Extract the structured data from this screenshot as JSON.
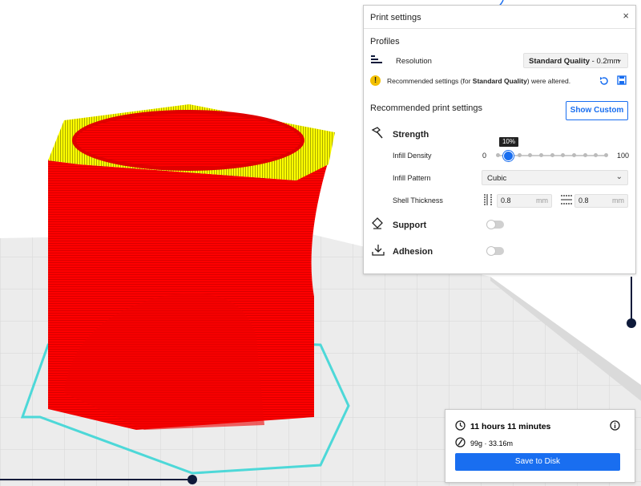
{
  "print_settings": {
    "title": "Print settings",
    "close_label": "×",
    "profiles_label": "Profiles",
    "resolution_label": "Resolution",
    "resolution_value_bold": "Standard Quality",
    "resolution_value_rest": " - 0.2mm",
    "warning": {
      "prefix": "Recommended settings (for ",
      "bold": "Standard Quality",
      "suffix": ") were altered.",
      "icon": "exclamation-icon"
    },
    "recommended_title": "Recommended print settings",
    "show_custom_label": "Show Custom",
    "strength_label": "Strength",
    "infill_density_label": "Infill Density",
    "infill_density_value": "10%",
    "infill_density_fraction": 0.1,
    "slider_min": "0",
    "slider_max": "100",
    "infill_pattern_label": "Infill Pattern",
    "infill_pattern_value": "Cubic",
    "shell_thickness_label": "Shell Thickness",
    "wall_thickness": "0.8",
    "top_bottom_thickness": "0.8",
    "unit": "mm",
    "support_label": "Support",
    "support_enabled": false,
    "adhesion_label": "Adhesion",
    "adhesion_enabled": false
  },
  "job": {
    "time": "11 hours 11 minutes",
    "material": "99g · 33.16m",
    "save_label": "Save to Disk"
  },
  "colors": {
    "accent": "#196ef0",
    "model_body": "#ff0000",
    "model_top": "#ffff00",
    "build_outline": "#4dd8d8",
    "warning": "#f3c000"
  }
}
